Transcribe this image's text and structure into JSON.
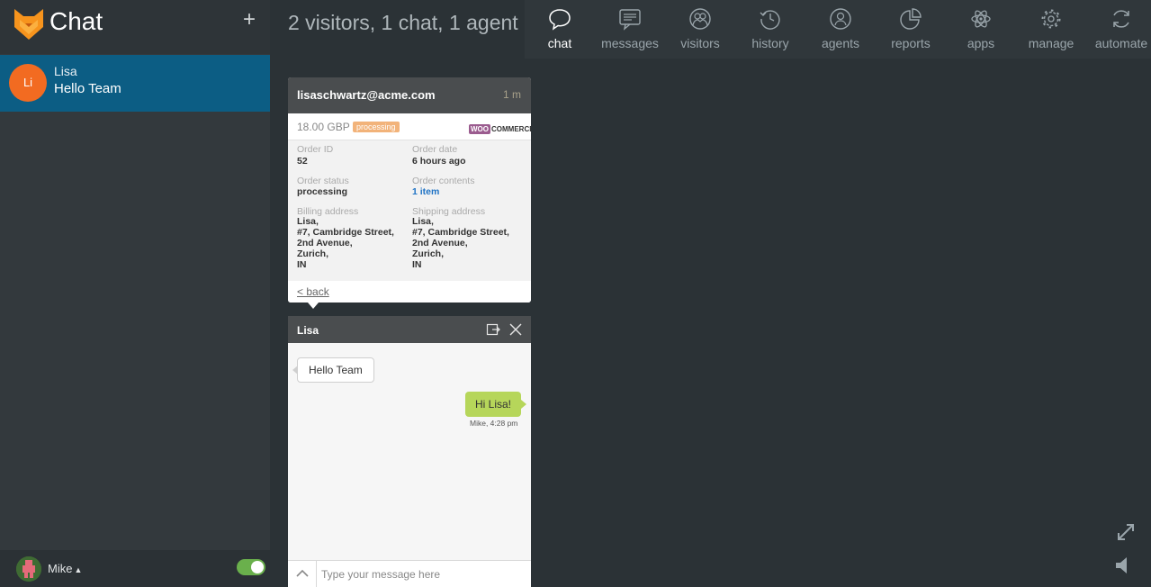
{
  "app": {
    "title": "Chat",
    "accent": "#0c5d84",
    "brand_color": "#f7941d"
  },
  "header": {
    "summary": "2 visitors, 1 chat, 1 agent"
  },
  "nav": [
    {
      "label": "chat",
      "icon": "chat-bubble-icon",
      "active": true
    },
    {
      "label": "messages",
      "icon": "messages-icon"
    },
    {
      "label": "visitors",
      "icon": "visitors-icon"
    },
    {
      "label": "history",
      "icon": "history-icon"
    },
    {
      "label": "agents",
      "icon": "agents-icon"
    },
    {
      "label": "reports",
      "icon": "reports-icon"
    },
    {
      "label": "apps",
      "icon": "apps-icon"
    },
    {
      "label": "manage",
      "icon": "gear-icon"
    },
    {
      "label": "automate",
      "icon": "refresh-icon"
    }
  ],
  "chats": [
    {
      "initials": "Li",
      "name": "Lisa",
      "preview": "Hello Team",
      "avatar_color": "#f26b21"
    }
  ],
  "footer": {
    "agent_name": "Mike",
    "caret": "▲",
    "online": true
  },
  "order": {
    "email": "lisaschwartz@acme.com",
    "age": "1 m",
    "amount": "18.00 GBP",
    "status_badge": "processing",
    "provider_a": "WOO",
    "provider_b": "COMMERCE",
    "order_id_label": "Order ID",
    "order_id": "52",
    "order_date_label": "Order date",
    "order_date": "6 hours ago",
    "order_status_label": "Order status",
    "order_status": "processing",
    "order_contents_label": "Order contents",
    "order_contents": "1 item",
    "billing_label": "Billing address",
    "billing": [
      "Lisa,",
      "#7, Cambridge Street,",
      "2nd Avenue,",
      "Zurich,",
      "IN"
    ],
    "shipping_label": "Shipping address",
    "shipping": [
      "Lisa,",
      "#7, Cambridge Street,",
      "2nd Avenue,",
      "Zurich,",
      "IN"
    ],
    "back": "< back"
  },
  "conversation": {
    "name": "Lisa",
    "messages": [
      {
        "from": "visitor",
        "text": "Hello Team"
      },
      {
        "from": "agent",
        "text": "Hi Lisa!",
        "meta": "Mike, 4:28 pm"
      }
    ],
    "input_placeholder": "Type your message here"
  }
}
